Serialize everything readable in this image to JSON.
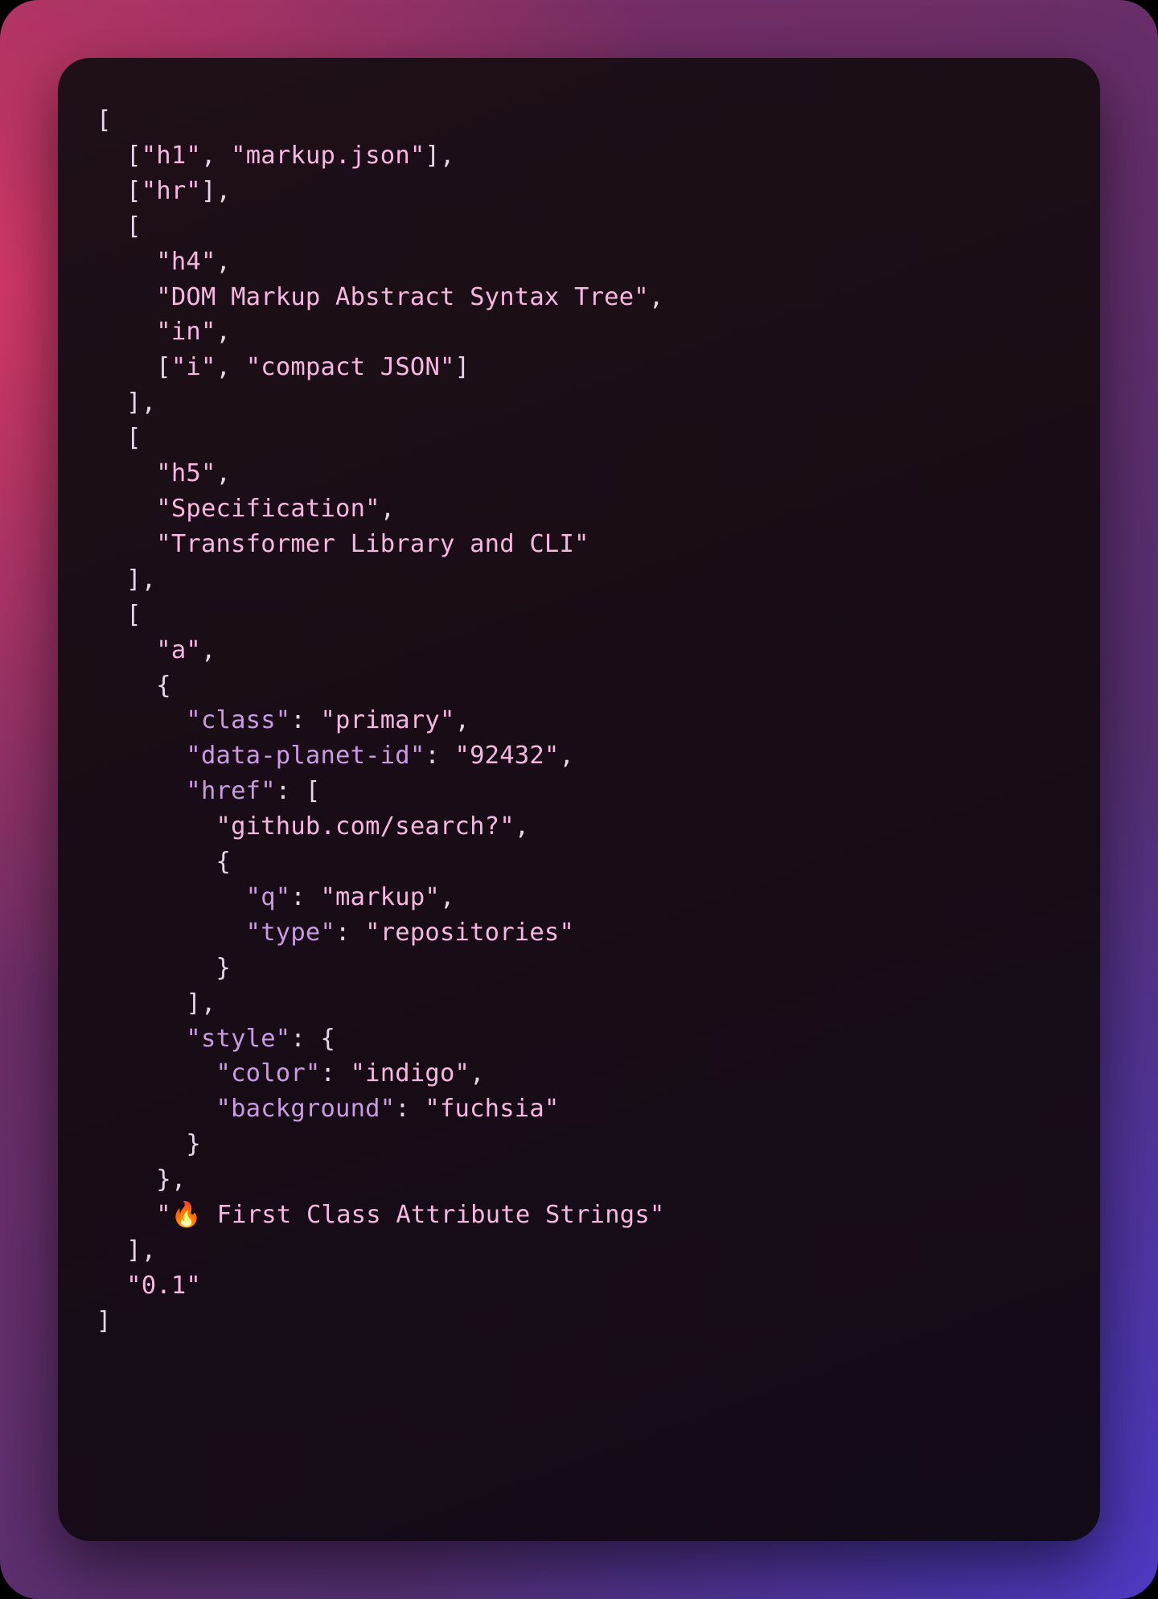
{
  "code": {
    "line1_open": "[",
    "h1_tag": "\"h1\"",
    "h1_val": "\"markup.json\"",
    "hr_tag": "\"hr\"",
    "h4_tag": "\"h4\"",
    "h4_s1": "\"DOM Markup Abstract Syntax Tree\"",
    "h4_s2": "\"in\"",
    "i_tag": "\"i\"",
    "i_val": "\"compact JSON\"",
    "h5_tag": "\"h5\"",
    "h5_s1": "\"Specification\"",
    "h5_s2": "\"Transformer Library and CLI\"",
    "a_tag": "\"a\"",
    "class_key": "\"class\"",
    "class_val": "\"primary\"",
    "planet_key": "\"data-planet-id\"",
    "planet_val": "\"92432\"",
    "href_key": "\"href\"",
    "href_url": "\"github.com/search?\"",
    "q_key": "\"q\"",
    "q_val": "\"markup\"",
    "type_key": "\"type\"",
    "type_val": "\"repositories\"",
    "style_key": "\"style\"",
    "color_key": "\"color\"",
    "color_val": "\"indigo\"",
    "bg_key": "\"background\"",
    "bg_val": "\"fuchsia\"",
    "fire_text_prefix": "\"",
    "fire_emoji": "🔥",
    "fire_text_suffix": " First Class Attribute Strings\"",
    "version": "\"0.1\"",
    "ind1": "  ",
    "ind2": "    ",
    "ind3": "      ",
    "ind4": "        ",
    "ind5": "          ",
    "comma": ",",
    "colon_sp": ": ",
    "lbracket": "[",
    "rbracket": "]",
    "lbrace": "{",
    "rbrace": "}"
  }
}
